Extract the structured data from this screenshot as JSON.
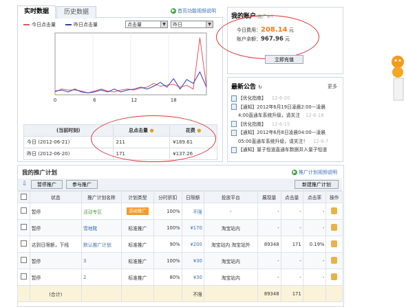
{
  "tabs": {
    "realtime": "实时数据",
    "history": "历史数据"
  },
  "help": {
    "home_video": "首页功能视频说明",
    "plan_video": "推广计划视频说明"
  },
  "legend": {
    "today": "今日点击量",
    "yesterday": "昨日点击量"
  },
  "selects": {
    "metric": "点击量",
    "day": "昨日"
  },
  "colors": {
    "today": "#e8525a",
    "yesterday": "#2d39b8",
    "accent": "#f07a1e",
    "ellipse": "#dd3333"
  },
  "chart_data": {
    "type": "line",
    "x_ticks": [
      "0",
      "6",
      "12",
      "18"
    ],
    "ylim": [
      0,
      65
    ],
    "x": [
      0,
      1,
      2,
      3,
      4,
      5,
      6,
      7,
      8,
      9,
      10,
      11,
      12,
      13,
      14,
      15,
      16,
      17,
      18,
      19,
      20,
      21,
      22,
      23
    ],
    "series": [
      {
        "name": "今日点击量",
        "values": [
          3,
          6,
          5,
          5,
          4,
          2,
          4,
          6,
          4,
          3,
          5,
          6,
          5,
          7,
          8,
          12,
          9,
          10,
          11,
          8,
          10,
          6,
          60,
          9
        ]
      },
      {
        "name": "昨日点击量",
        "values": [
          4,
          5,
          3,
          6,
          3,
          2,
          3,
          5,
          3,
          6,
          3,
          5,
          6,
          8,
          6,
          9,
          13,
          8,
          17,
          6,
          16,
          12,
          24,
          8
        ]
      }
    ]
  },
  "summary": {
    "headers": [
      "(当前时刻)",
      "总点击量",
      "花费"
    ],
    "rows": [
      [
        "今日 (2012-06-21)",
        "211",
        "¥189.61"
      ],
      [
        "昨日 (2012-06-20)",
        "171",
        "¥137.26"
      ]
    ]
  },
  "account": {
    "title": "我的账户",
    "sub": "(推广中)",
    "today_cost_label": "今日费用：",
    "today_cost": "208.14",
    "unit": "元",
    "balance_label": "账户余额：",
    "balance": "967.96",
    "recharge": "立即充值"
  },
  "notice": {
    "title": "最新公告",
    "refresh_icon": "refresh-icon",
    "more": "更多",
    "items": [
      {
        "text": "【优化指南】",
        "date": "12-6-20"
      },
      {
        "text": "【通知】2012年6月19日凌晨2:00—凌晨",
        "date": ""
      },
      {
        "text": "4:00直通车系统升级，请关注",
        "date": "12-6-18"
      },
      {
        "text": "【优化指南】",
        "date": "12-6-15"
      },
      {
        "text": "【通知】2012年6月8日凌晨04:00—凌晨",
        "date": ""
      },
      {
        "text": "05:00直通车系统升级，请关注！",
        "date": "12-6-7"
      },
      {
        "text": "【通知】量子恒道直通车数据并入量子恒道",
        "date": ""
      }
    ]
  },
  "plans": {
    "title": "我的推广计划",
    "pause_btn": "暂停推广",
    "join_btn": "参与推广",
    "new_btn": "新建推广计划",
    "headers": [
      "",
      "状态",
      "推广计划名称",
      "计划类型",
      "分时折扣",
      "日限额",
      "投放平台",
      "展现量",
      "点击量",
      "点击率",
      "操作"
    ],
    "rows": [
      [
        "",
        "暂停",
        "活动专区",
        "活动推广",
        "100%",
        "不限",
        "-",
        "-",
        "-",
        "-",
        ""
      ],
      [
        "",
        "暂停",
        "雪地靴",
        "标准推广",
        "100%",
        "¥170",
        "淘宝站内",
        "-",
        "-",
        "-",
        ""
      ],
      [
        "",
        "达到日限额，下线",
        "默认推广计划",
        "标准推广",
        "90%",
        "¥200",
        "淘宝站内 淘宝站外",
        "89348",
        "171",
        "0.19%",
        ""
      ],
      [
        "",
        "暂停",
        "3",
        "标准推广",
        "100%",
        "¥30",
        "淘宝站内",
        "-",
        "-",
        "-",
        ""
      ],
      [
        "",
        "暂停",
        "2",
        "标准推广",
        "80%",
        "¥30",
        "淘宝站内",
        "-",
        "-",
        "-",
        ""
      ]
    ],
    "total": [
      "",
      "(合计)",
      "",
      "",
      "",
      "不限",
      "",
      "89348",
      "171",
      "",
      ""
    ]
  }
}
